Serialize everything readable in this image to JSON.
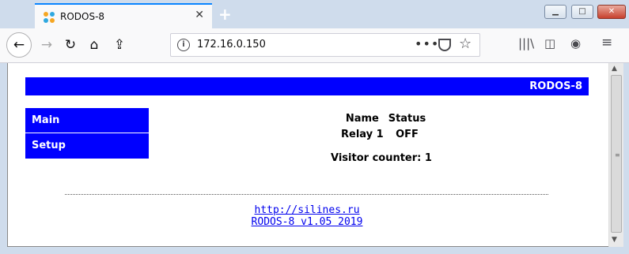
{
  "browser": {
    "tab_title": "RODOS-8",
    "url": "172.16.0.150",
    "url_more": "•••"
  },
  "page": {
    "header_title": "RODOS-8",
    "menu": [
      {
        "label": "Main"
      },
      {
        "label": "Setup"
      }
    ],
    "status_table": {
      "headers": [
        "Name",
        "Status"
      ],
      "rows": [
        [
          "Relay 1",
          "OFF"
        ]
      ]
    },
    "visitor_counter": "Visitor counter: 1",
    "footer_links": [
      "http://silines.ru",
      "RODOS-8 v1.05 2019"
    ]
  },
  "colors": {
    "accent_blue": "#0000ff",
    "link": "#0000ee",
    "tab_highlight": "#0a84ff"
  }
}
